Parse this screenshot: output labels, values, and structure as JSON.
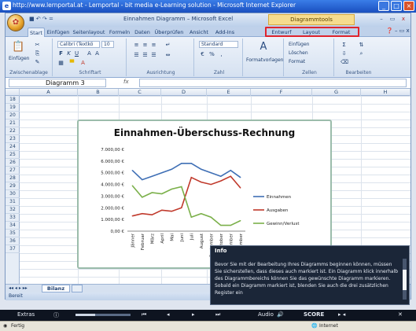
{
  "browser": {
    "title": "http://www.lernportal.at - Lernportal - bit media e-Learning solution - Microsoft Internet Explorer",
    "status_left": "Fertig",
    "status_right": "Internet"
  },
  "excel": {
    "qat": "■ ↶ ↷ =",
    "doc_title": "Einnahmen Diagramm – Microsoft Excel",
    "context_title": "Diagrammtools",
    "tabs": [
      "Start",
      "Einfügen",
      "Seitenlayout",
      "Formeln",
      "Daten",
      "Überprüfen",
      "Ansicht",
      "Add-Ins"
    ],
    "context_tabs": [
      "Entwurf",
      "Layout",
      "Format"
    ],
    "help": "❓ – ▭ x",
    "ribbon": {
      "paste_label": "Einfügen",
      "font_name": "Calibri (Textkö",
      "font_size": "10",
      "number_format": "Standard",
      "styles_label": "Formatvorlagen",
      "insert_label": "Einfügen",
      "delete_label": "Löschen",
      "format_label": "Format",
      "groups": [
        "Zwischenablage",
        "Schriftart",
        "Ausrichtung",
        "Zahl",
        "Zellen",
        "Bearbeiten"
      ]
    },
    "name_box": "Diagramm 3",
    "fx": "fx",
    "columns": [
      "A",
      "B",
      "C",
      "D",
      "E",
      "F",
      "G",
      "H"
    ],
    "rows": [
      "18",
      "19",
      "20",
      "21",
      "22",
      "23",
      "24",
      "25",
      "26",
      "27",
      "28",
      "29",
      "30",
      "31",
      "32",
      "33",
      "34",
      "35",
      "36",
      "37"
    ],
    "sheet_tab": "Bilanz",
    "status": "Bereit"
  },
  "chart_data": {
    "type": "line",
    "title": "Einnahmen-Überschuss-Rechnung",
    "categories": [
      "Jänner",
      "Februar",
      "März",
      "April",
      "Mai",
      "Juni",
      "Juli",
      "August",
      "September",
      "Oktober",
      "November",
      "Dezember"
    ],
    "y_ticks": [
      "7.000,00 €",
      "6.000,00 €",
      "5.000,00 €",
      "4.000,00 €",
      "3.000,00 €",
      "2.000,00 €",
      "1.000,00 €",
      "0,00 €"
    ],
    "ylim": [
      0,
      7000
    ],
    "series": [
      {
        "name": "Einnahmen",
        "color": "#3f6fb5",
        "values": [
          5200,
          4400,
          4700,
          5000,
          5300,
          5800,
          5800,
          5300,
          5000,
          4700,
          5200,
          4600
        ]
      },
      {
        "name": "Ausgaben",
        "color": "#c0392b",
        "values": [
          1300,
          1500,
          1400,
          1800,
          1700,
          2000,
          4600,
          4200,
          4000,
          4300,
          4700,
          3700
        ]
      },
      {
        "name": "Gewinn/Verlust",
        "color": "#7bb04a",
        "values": [
          3900,
          2900,
          3300,
          3200,
          3600,
          3800,
          1200,
          1500,
          1200,
          500,
          500,
          900
        ]
      }
    ],
    "legend": "right",
    "grid": false
  },
  "info": {
    "title": "Info",
    "body": "Bevor Sie mit der Bearbeitung Ihres Diagramms beginnen können, müssen Sie sicherstellen, dass dieses auch markiert ist. Ein Diagramm klick innerhalb des Diagrammbereichs können Sie das gewünschte Diagramm markieren. Sobald ein Diagramm markiert ist, blenden Sie auch die drei zusätzlichen Register ein"
  },
  "player": {
    "extras": "Extras",
    "audio": "Audio",
    "score": "SCORE",
    "progress": 0.35
  }
}
